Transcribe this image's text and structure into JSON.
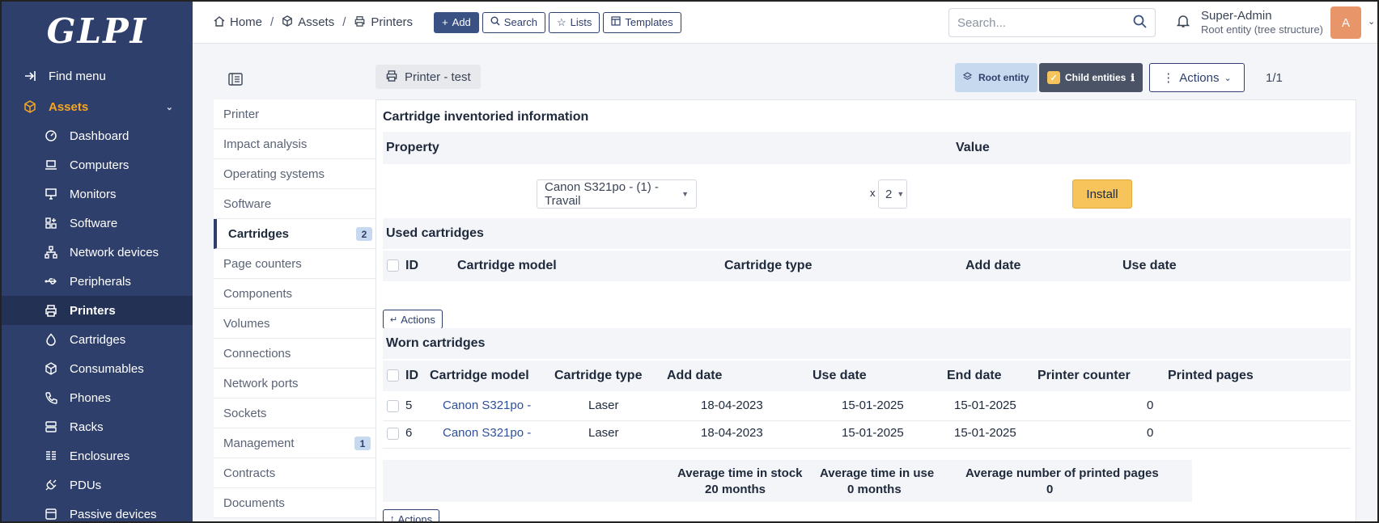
{
  "sidebar": {
    "logo": "GLPI",
    "find_menu": "Find menu",
    "section": "Assets",
    "items": [
      {
        "label": "Dashboard",
        "icon": "dashboard-icon"
      },
      {
        "label": "Computers",
        "icon": "laptop-icon"
      },
      {
        "label": "Monitors",
        "icon": "monitor-icon"
      },
      {
        "label": "Software",
        "icon": "apps-icon"
      },
      {
        "label": "Network devices",
        "icon": "network-icon"
      },
      {
        "label": "Peripherals",
        "icon": "usb-icon"
      },
      {
        "label": "Printers",
        "icon": "printer-icon"
      },
      {
        "label": "Cartridges",
        "icon": "droplet-icon"
      },
      {
        "label": "Consumables",
        "icon": "package-icon"
      },
      {
        "label": "Phones",
        "icon": "phone-icon"
      },
      {
        "label": "Racks",
        "icon": "server-icon"
      },
      {
        "label": "Enclosures",
        "icon": "columns-icon"
      },
      {
        "label": "PDUs",
        "icon": "plug-icon"
      },
      {
        "label": "Passive devices",
        "icon": "box-icon"
      }
    ]
  },
  "header": {
    "breadcrumb": [
      "Home",
      "Assets",
      "Printers"
    ],
    "buttons": {
      "add": "Add",
      "search": "Search",
      "lists": "Lists",
      "templates": "Templates"
    },
    "search_placeholder": "Search...",
    "user_name": "Super-Admin",
    "user_entity": "Root entity (tree structure)",
    "avatar_letter": "A"
  },
  "toolbar": {
    "item_name": "Printer - test",
    "root_entity": "Root entity",
    "child_entities": "Child entities",
    "actions": "Actions",
    "pager": "1/1"
  },
  "tabs": [
    {
      "label": "Printer"
    },
    {
      "label": "Impact analysis"
    },
    {
      "label": "Operating systems"
    },
    {
      "label": "Software"
    },
    {
      "label": "Cartridges",
      "badge": "2"
    },
    {
      "label": "Page counters"
    },
    {
      "label": "Components"
    },
    {
      "label": "Volumes"
    },
    {
      "label": "Connections"
    },
    {
      "label": "Network ports"
    },
    {
      "label": "Sockets"
    },
    {
      "label": "Management",
      "badge": "1"
    },
    {
      "label": "Contracts"
    },
    {
      "label": "Documents"
    }
  ],
  "main": {
    "inventoried_title": "Cartridge inventoried information",
    "property_header": "Property",
    "value_header": "Value",
    "model_select": "Canon S321po - (1) - Travail",
    "qty_prefix": "x",
    "qty_select": "2",
    "install_label": "Install",
    "used_title": "Used cartridges",
    "used_headers": [
      "ID",
      "Cartridge model",
      "Cartridge type",
      "Add date",
      "Use date"
    ],
    "actions_label": "Actions",
    "worn_title": "Worn cartridges",
    "worn_headers": [
      "ID",
      "Cartridge model",
      "Cartridge type",
      "Add date",
      "Use date",
      "End date",
      "Printer counter",
      "Printed pages"
    ],
    "worn_rows": [
      {
        "id": "5",
        "model": "Canon S321po -",
        "type": "Laser",
        "add": "18-04-2023",
        "use": "15-01-2025",
        "end": "15-01-2025",
        "pages": "0"
      },
      {
        "id": "6",
        "model": "Canon S321po -",
        "type": "Laser",
        "add": "18-04-2023",
        "use": "15-01-2025",
        "end": "15-01-2025",
        "pages": "0"
      }
    ],
    "stats": {
      "stock_label": "Average time in stock",
      "stock_value": "20 months",
      "use_label": "Average time in use",
      "use_value": "0 months",
      "pages_label": "Average number of printed pages",
      "pages_value": "0"
    }
  },
  "colors": {
    "sidebar": "#2e3f6b",
    "accent": "#f5a623",
    "install": "#f6c45a"
  }
}
